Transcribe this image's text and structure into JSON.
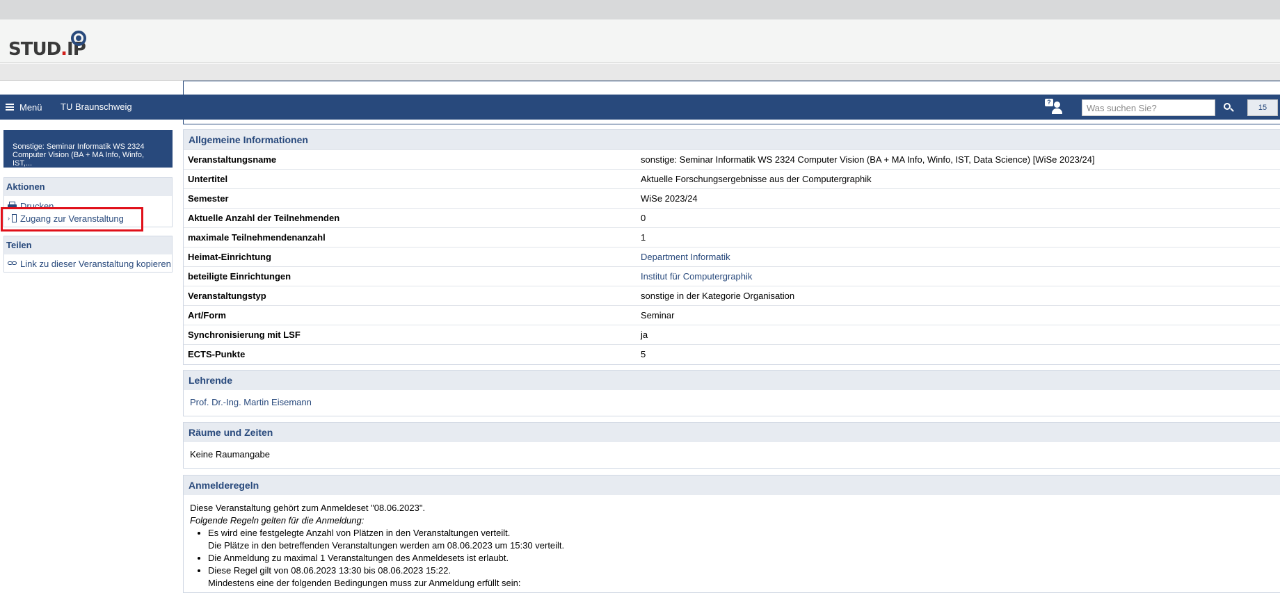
{
  "header": {
    "logo_text_a": "STUD",
    "logo_text_dot": ".",
    "logo_text_b": "IP"
  },
  "nav": {
    "menu_label": "Menü",
    "institution": "TU Braunschweig",
    "help_icon_glyph": "?",
    "search_placeholder": "Was suchen Sie?",
    "notification_count": "15",
    "color": "#28497c"
  },
  "sidebar": {
    "course_header": "Sonstige: Seminar Informatik WS 2324 Computer Vision (BA + MA Info, Winfo, IST,...",
    "actions_title": "Aktionen",
    "actions": [
      {
        "label": "Drucken",
        "icon": "print-icon"
      },
      {
        "label": "Zugang zur Veranstaltung",
        "icon": "door-enter-icon"
      }
    ],
    "share_title": "Teilen",
    "share": [
      {
        "label": "Link zu dieser Veranstaltung kopieren",
        "icon": "link-icon"
      }
    ]
  },
  "general": {
    "title": "Allgemeine Informationen",
    "rows": [
      {
        "key": "Veranstaltungsname",
        "value": "sonstige: Seminar Informatik WS 2324 Computer Vision (BA + MA Info, Winfo, IST, Data Science) [WiSe 2023/24]"
      },
      {
        "key": "Untertitel",
        "value": "Aktuelle Forschungsergebnisse aus der Computergraphik"
      },
      {
        "key": "Semester",
        "value": "WiSe 2023/24"
      },
      {
        "key": "Aktuelle Anzahl der Teilnehmenden",
        "value": "0"
      },
      {
        "key": "maximale Teilnehmendenanzahl",
        "value": "1"
      },
      {
        "key": "Heimat-Einrichtung",
        "value": "Department Informatik"
      },
      {
        "key": "beteiligte Einrichtungen",
        "value": "Institut für Computergraphik"
      },
      {
        "key": "Veranstaltungstyp",
        "value": "sonstige in der Kategorie Organisation"
      },
      {
        "key": "Art/Form",
        "value": "Seminar"
      },
      {
        "key": "Synchronisierung mit LSF",
        "value": "ja"
      },
      {
        "key": "ECTS-Punkte",
        "value": "5"
      }
    ]
  },
  "lecturers": {
    "title": "Lehrende",
    "name": "Prof. Dr.-Ing. Martin Eisemann"
  },
  "rooms": {
    "title": "Räume und Zeiten",
    "text": "Keine Raumangabe"
  },
  "rules": {
    "title": "Anmelderegeln",
    "intro": "Diese Veranstaltung gehört zum Anmeldeset \"08.06.2023\".",
    "subtitle": "Folgende Regeln gelten für die Anmeldung:",
    "item1_a": "Es wird eine festgelegte Anzahl von Plätzen in den Veranstaltungen verteilt.",
    "item1_b": "Die Plätze in den betreffenden Veranstaltungen werden am 08.06.2023 um 15:30 verteilt.",
    "item2": "Die Anmeldung zu maximal 1 Veranstaltungen des Anmeldesets ist erlaubt.",
    "item3_a": "Diese Regel gilt von 08.06.2023 13:30 bis 08.06.2023 15:22.",
    "item3_b": "Mindestens eine der folgenden Bedingungen muss zur Anmeldung erfüllt sein:"
  }
}
